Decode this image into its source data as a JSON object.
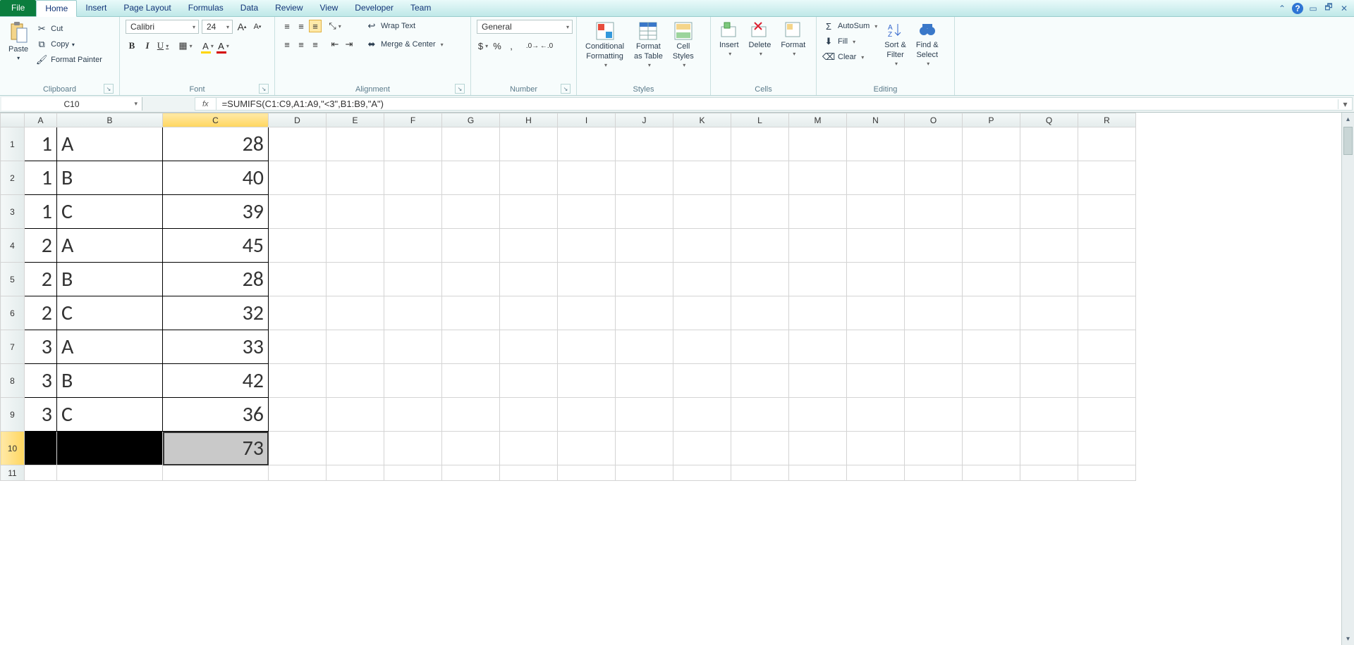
{
  "tabs": {
    "file": "File",
    "items": [
      "Home",
      "Insert",
      "Page Layout",
      "Formulas",
      "Data",
      "Review",
      "View",
      "Developer",
      "Team"
    ],
    "active": "Home"
  },
  "ribbon": {
    "clipboard": {
      "label": "Clipboard",
      "paste": "Paste",
      "cut": "Cut",
      "copy": "Copy",
      "format_painter": "Format Painter"
    },
    "font": {
      "label": "Font",
      "name": "Calibri",
      "size": "24"
    },
    "alignment": {
      "label": "Alignment",
      "wrap": "Wrap Text",
      "merge": "Merge & Center"
    },
    "number": {
      "label": "Number",
      "format": "General"
    },
    "styles": {
      "label": "Styles",
      "cond": "Conditional",
      "cond2": "Formatting",
      "fmt": "Format",
      "fmt2": "as Table",
      "cell": "Cell",
      "cell2": "Styles"
    },
    "cells": {
      "label": "Cells",
      "insert": "Insert",
      "delete": "Delete",
      "format": "Format"
    },
    "editing": {
      "label": "Editing",
      "autosum": "AutoSum",
      "fill": "Fill",
      "clear": "Clear",
      "sort": "Sort &",
      "sort2": "Filter",
      "find": "Find &",
      "find2": "Select"
    }
  },
  "namebox": "C10",
  "formula": "=SUMIFS(C1:C9,A1:A9,\"<3\",B1:B9,\"A\")",
  "columns": [
    "A",
    "B",
    "C",
    "D",
    "E",
    "F",
    "G",
    "H",
    "I",
    "J",
    "K",
    "L",
    "M",
    "N",
    "O",
    "P",
    "Q",
    "R"
  ],
  "selected_col": "C",
  "selected_row": 10,
  "cells": {
    "r1": {
      "A": "1",
      "B": "A",
      "C": "28"
    },
    "r2": {
      "A": "1",
      "B": "B",
      "C": "40"
    },
    "r3": {
      "A": "1",
      "B": "C",
      "C": "39"
    },
    "r4": {
      "A": "2",
      "B": "A",
      "C": "45"
    },
    "r5": {
      "A": "2",
      "B": "B",
      "C": "28"
    },
    "r6": {
      "A": "2",
      "B": "C",
      "C": "32"
    },
    "r7": {
      "A": "3",
      "B": "A",
      "C": "33"
    },
    "r8": {
      "A": "3",
      "B": "B",
      "C": "42"
    },
    "r9": {
      "A": "3",
      "B": "C",
      "C": "36"
    },
    "r10": {
      "C": "73"
    }
  },
  "row_headers": [
    "1",
    "2",
    "3",
    "4",
    "5",
    "6",
    "7",
    "8",
    "9",
    "10",
    "11"
  ],
  "chart_data": {
    "type": "table",
    "title": "",
    "columns": [
      "A",
      "B",
      "C"
    ],
    "rows": [
      [
        1,
        "A",
        28
      ],
      [
        1,
        "B",
        40
      ],
      [
        1,
        "C",
        39
      ],
      [
        2,
        "A",
        45
      ],
      [
        2,
        "B",
        28
      ],
      [
        2,
        "C",
        32
      ],
      [
        3,
        "A",
        33
      ],
      [
        3,
        "B",
        42
      ],
      [
        3,
        "C",
        36
      ]
    ],
    "computed": {
      "cell": "C10",
      "formula": "=SUMIFS(C1:C9,A1:A9,\"<3\",B1:B9,\"A\")",
      "value": 73
    }
  }
}
